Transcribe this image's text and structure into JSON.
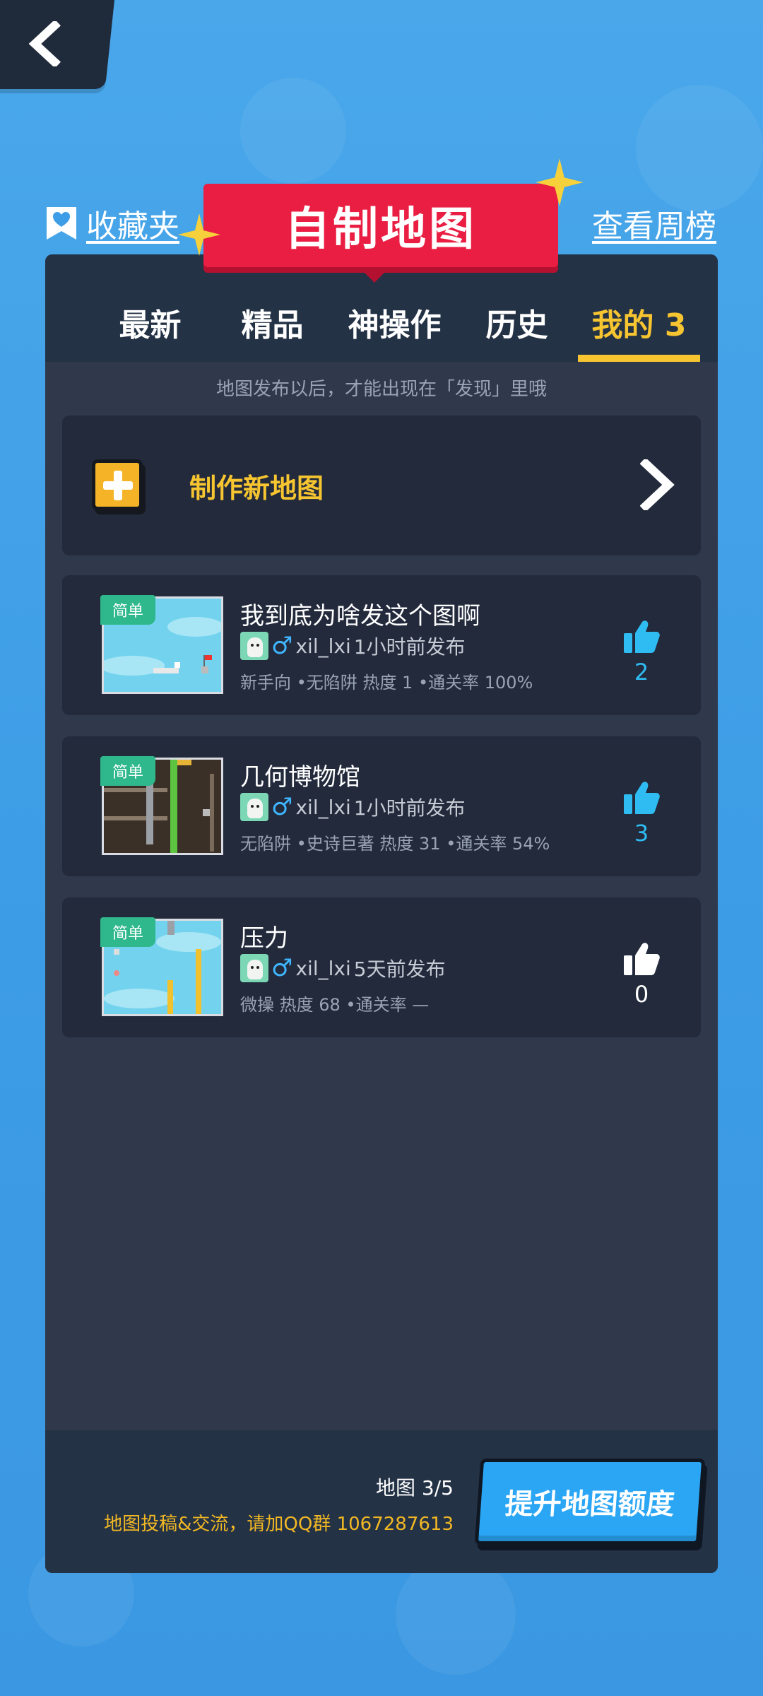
{
  "header": {
    "title": "自制地图",
    "favorites_label": "收藏夹",
    "weekly_rank_label": "查看周榜"
  },
  "tabs": [
    {
      "label": "最新",
      "active": false
    },
    {
      "label": "精品",
      "active": false
    },
    {
      "label": "神操作",
      "active": false
    },
    {
      "label": "历史",
      "active": false
    },
    {
      "label": "我的 3",
      "active": true
    }
  ],
  "hint": "地图发布以后，才能出现在「发现」里哦",
  "new_map": {
    "label": "制作新地图"
  },
  "maps": [
    {
      "badge": "简单",
      "name": "我到底为啥发这个图啊",
      "author": "xil_lxi",
      "published": "1小时前发布",
      "stats": "新手向 •无陷阱 热度 1 •通关率 100%",
      "likes": "2",
      "liked": true
    },
    {
      "badge": "简单",
      "name": "几何博物馆",
      "author": "xil_lxi",
      "published": "1小时前发布",
      "stats": "无陷阱 •史诗巨著 热度 31 •通关率 54%",
      "likes": "3",
      "liked": true
    },
    {
      "badge": "简单",
      "name": "压力",
      "author": "xil_lxi",
      "published": "5天前发布",
      "stats": "微操 热度 68 •通关率 —",
      "likes": "0",
      "liked": false
    }
  ],
  "footer": {
    "quota": "地图 3/5",
    "group_info": "地图投稿&交流，请加QQ群 1067287613",
    "upgrade_label": "提升地图额度"
  },
  "icons": {
    "back": "back-arrow-icon",
    "favorites": "bookmark-heart-icon",
    "plus": "plus-icon",
    "chevron": "chevron-right-icon",
    "like": "thumbs-up-icon"
  },
  "colors": {
    "accent": "#f7c530",
    "banner": "#ea1e43",
    "like_active": "#2fbcf2",
    "badge": "#2fb88b",
    "button": "#2ba6f5"
  }
}
